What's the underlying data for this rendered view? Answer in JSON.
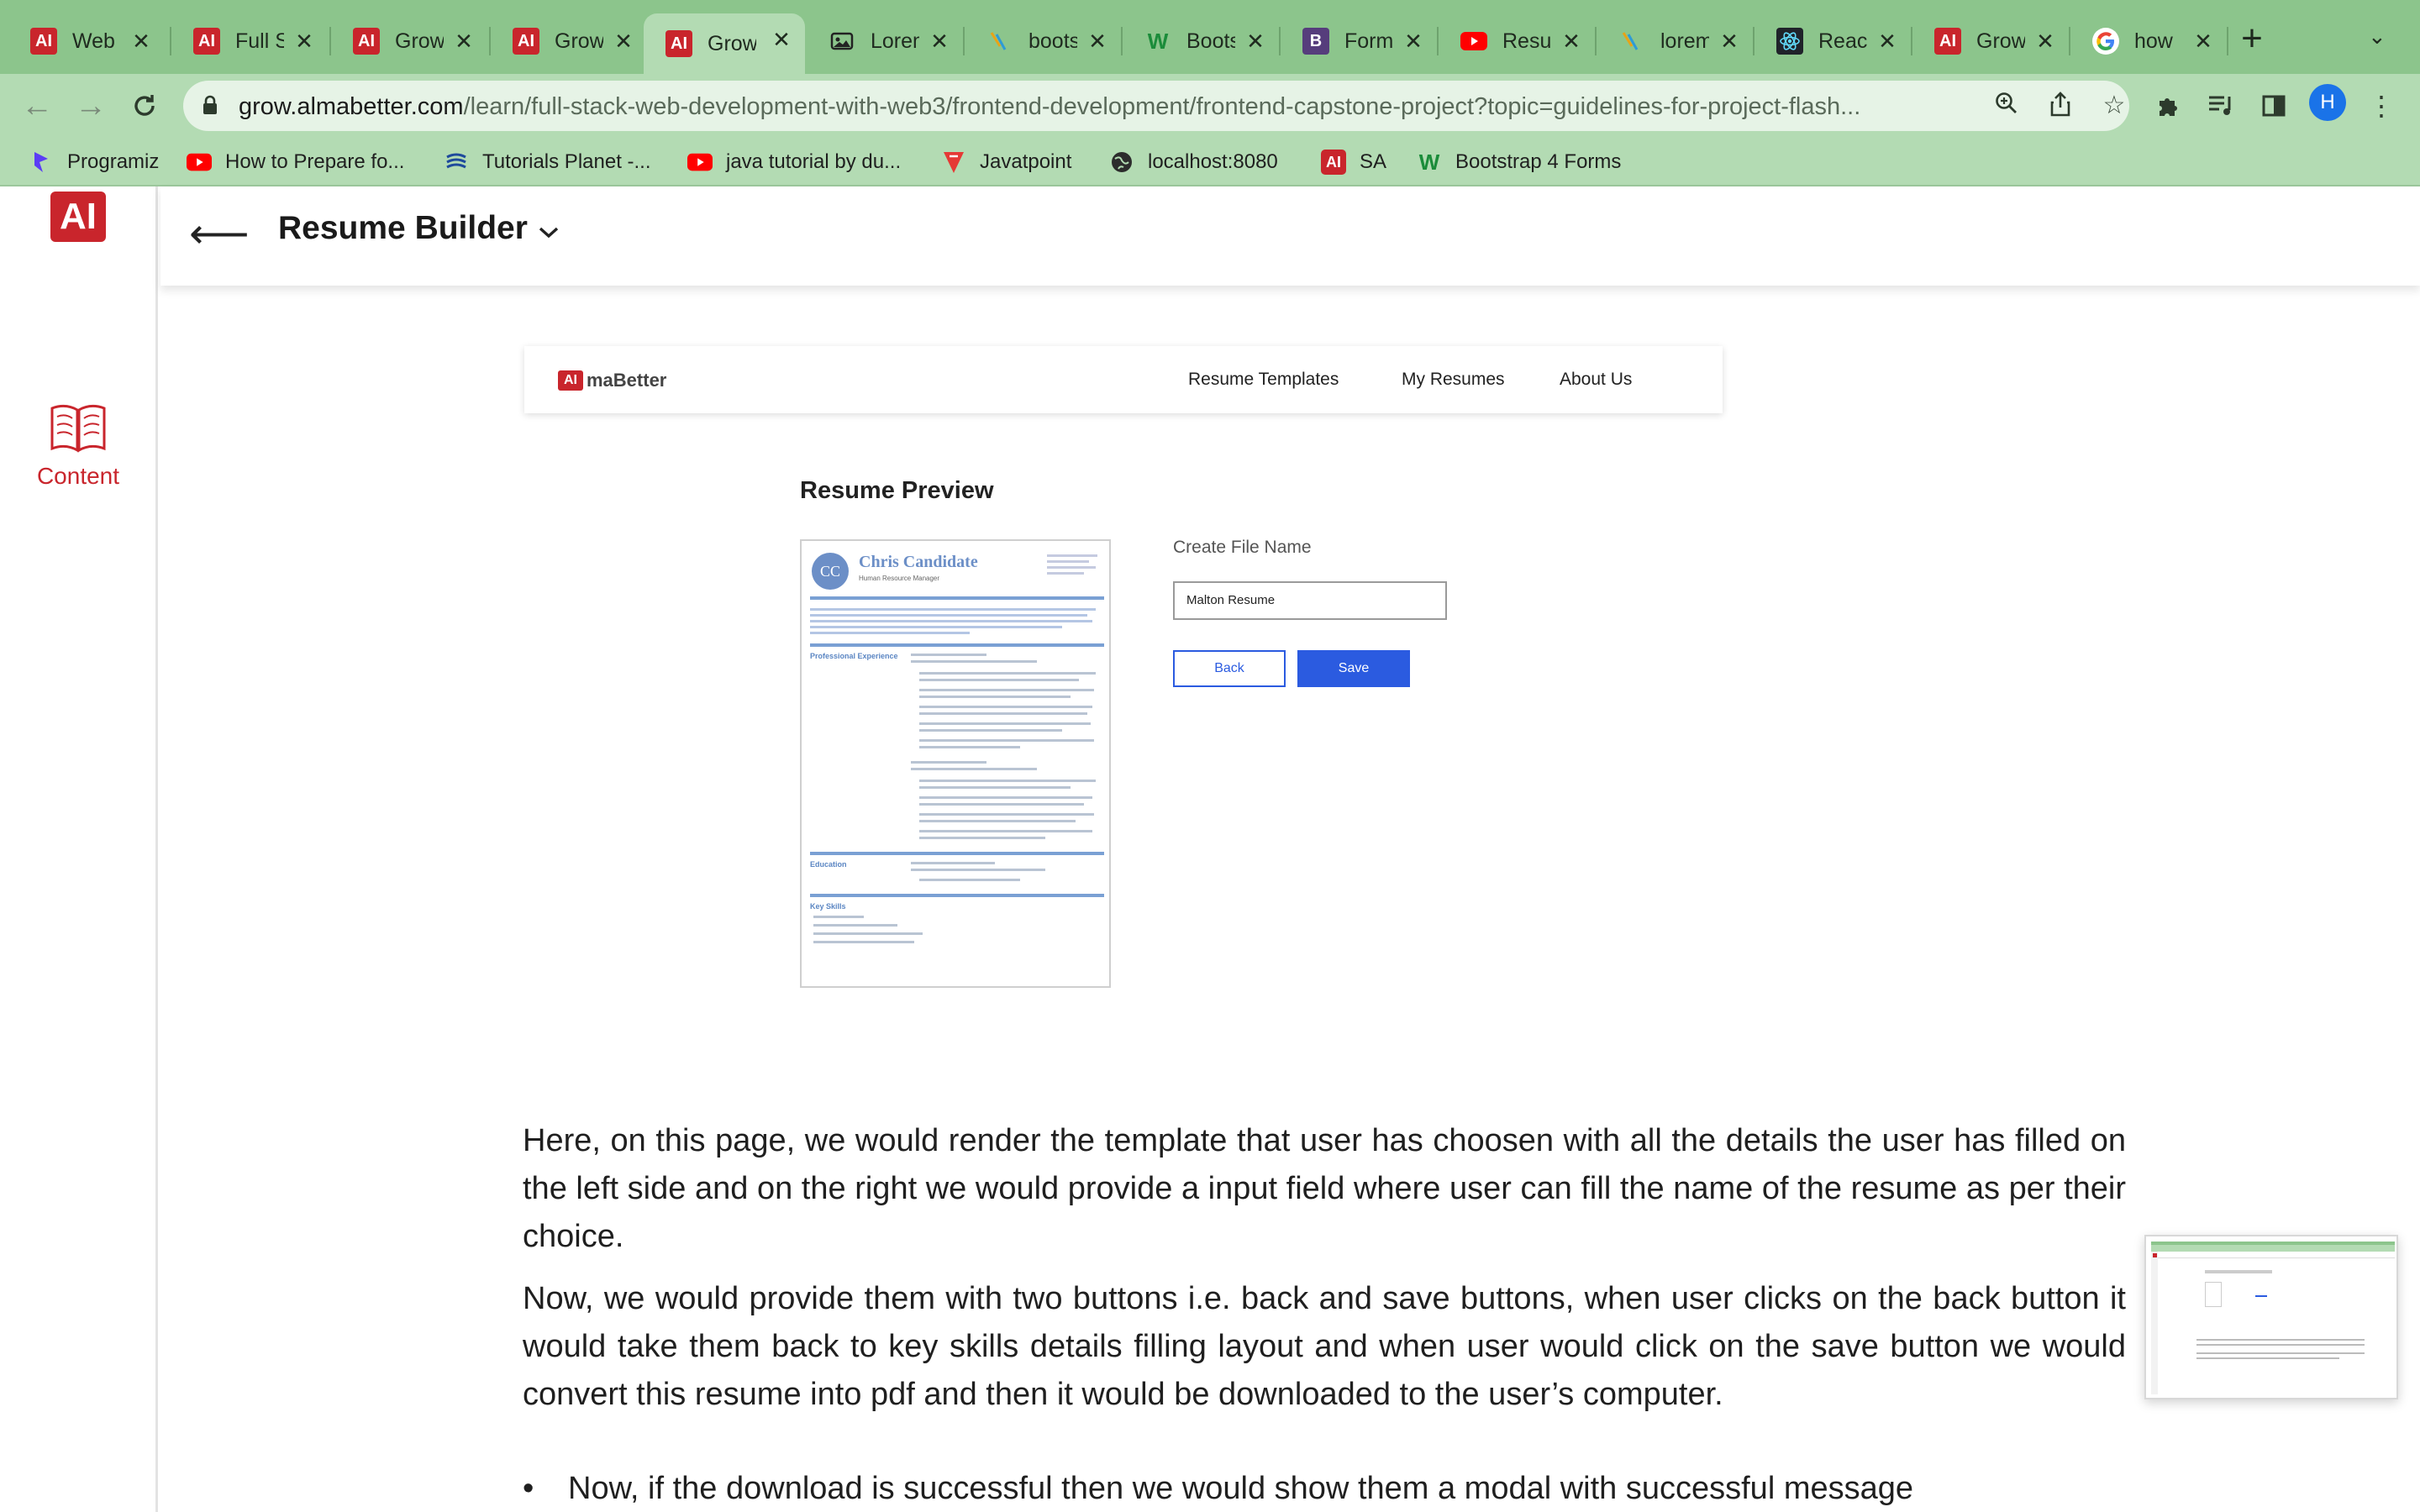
{
  "tabs": [
    {
      "title": "Web",
      "favicon": "almabetter-icon"
    },
    {
      "title": "Full S",
      "favicon": "almabetter-icon"
    },
    {
      "title": "Grow",
      "favicon": "almabetter-icon"
    },
    {
      "title": "Grow",
      "favicon": "almabetter-icon"
    },
    {
      "title": "Grow",
      "favicon": "almabetter-icon",
      "active": true
    },
    {
      "title": "Lorem",
      "favicon": "image-icon"
    },
    {
      "title": "boots",
      "favicon": "sparkle-icon"
    },
    {
      "title": "Boots",
      "favicon": "w3-icon"
    },
    {
      "title": "Form",
      "favicon": "bootstrap-icon"
    },
    {
      "title": "Resu",
      "favicon": "youtube-icon"
    },
    {
      "title": "lorem",
      "favicon": "sparkle-icon"
    },
    {
      "title": "Reac",
      "favicon": "react-icon"
    },
    {
      "title": "Grow",
      "favicon": "almabetter-icon"
    },
    {
      "title": "how",
      "favicon": "google-icon"
    }
  ],
  "address_bar": {
    "host": "grow.almabetter.com",
    "path": "/learn/full-stack-web-development-with-web3/frontend-development/frontend-capstone-project?topic=guidelines-for-project-flash..."
  },
  "profile_initial": "H",
  "bookmarks": [
    {
      "label": "Programiz",
      "icon": "programiz-icon"
    },
    {
      "label": "How to Prepare fo...",
      "icon": "youtube-icon"
    },
    {
      "label": "Tutorials Planet -...",
      "icon": "tutorials-planet-icon"
    },
    {
      "label": "java tutorial by du...",
      "icon": "youtube-icon"
    },
    {
      "label": "Javatpoint",
      "icon": "javatpoint-icon"
    },
    {
      "label": "localhost:8080",
      "icon": "globe-icon"
    },
    {
      "label": "SA",
      "icon": "almabetter-icon"
    },
    {
      "label": "Bootstrap 4 Forms",
      "icon": "w3-icon"
    }
  ],
  "rail": {
    "logo_text": "AI",
    "content_label": "Content"
  },
  "header": {
    "title": "Resume Builder"
  },
  "embedded": {
    "logo_mark": "AI",
    "logo_word": "maBetter",
    "nav": [
      "Resume Templates",
      "My Resumes",
      "About Us"
    ],
    "heading": "Resume Preview",
    "resume": {
      "initials": "CC",
      "name": "Chris Candidate",
      "role": "Human Resource Manager",
      "sections": [
        "Professional Experience",
        "Education",
        "Key Skills"
      ]
    },
    "form_label": "Create File Name",
    "input_value": "Malton Resume",
    "back_label": "Back",
    "save_label": "Save"
  },
  "body": {
    "p1": "Here, on this page, we would render the template that user has choosen with all the details the user has filled on the left side and on the right we would provide a input field where user can fill the name of the resume as per their choice.",
    "p2": "Now, we would provide them with two buttons i.e. back and save buttons, when user clicks on the back button it would take them back to key skills details filling layout and when user would click on the save button we would convert this resume into pdf and then it would be downloaded to the user’s computer.",
    "bullet1": "Now, if the download is successful then we would show them a modal with successful message"
  },
  "colors": {
    "tabstrip": "#8cc58c",
    "toolbar": "#b3dbb3",
    "brand_red": "#c9252c",
    "button_blue": "#2b5be0"
  }
}
